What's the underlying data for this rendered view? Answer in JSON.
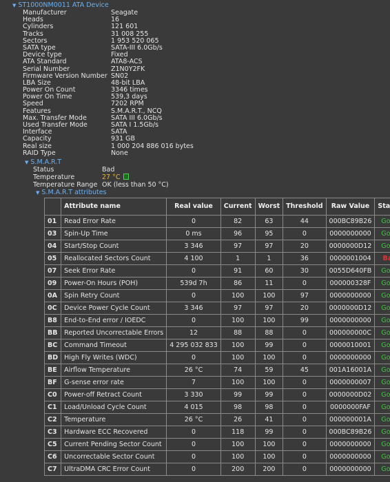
{
  "device": {
    "title": "ST1000NM0011 ATA Device"
  },
  "info": [
    {
      "key": "Manufacturer",
      "value": "Seagate"
    },
    {
      "key": "Heads",
      "value": "16"
    },
    {
      "key": "Cylinders",
      "value": "121 601"
    },
    {
      "key": "Tracks",
      "value": "31 008 255"
    },
    {
      "key": "Sectors",
      "value": "1 953 520 065"
    },
    {
      "key": "SATA type",
      "value": "SATA-III 6.0Gb/s"
    },
    {
      "key": "Device type",
      "value": "Fixed"
    },
    {
      "key": "ATA Standard",
      "value": "ATA8-ACS"
    },
    {
      "key": "Serial Number",
      "value": "Z1N0Y2FK"
    },
    {
      "key": "Firmware Version Number",
      "value": "SN02"
    },
    {
      "key": "LBA Size",
      "value": "48-bit LBA"
    },
    {
      "key": "Power On Count",
      "value": "3346 times"
    },
    {
      "key": "Power On Time",
      "value": "539,3 days"
    },
    {
      "key": "Speed",
      "value": "7202 RPM"
    },
    {
      "key": "Features",
      "value": "S.M.A.R.T., NCQ"
    },
    {
      "key": "Max. Transfer Mode",
      "value": "SATA III 6.0Gb/s"
    },
    {
      "key": "Used Transfer Mode",
      "value": "SATA I 1.5Gb/s"
    },
    {
      "key": "Interface",
      "value": "SATA"
    },
    {
      "key": "Capacity",
      "value": "931 GB"
    },
    {
      "key": "Real size",
      "value": "1 000 204 886 016 bytes"
    },
    {
      "key": "RAID Type",
      "value": "None"
    }
  ],
  "smart": {
    "title": "S.M.A.R.T",
    "status_label": "Status",
    "status_value": "Bad",
    "temp_label": "Temperature",
    "temp_value": "27 °C",
    "range_label": "Temperature Range",
    "range_value": "OK (less than 50 °C)",
    "attrs_title": "S.M.A.R.T attributes"
  },
  "table": {
    "headers": {
      "attribute": "Attribute name",
      "real": "Real value",
      "current": "Current",
      "worst": "Worst",
      "threshold": "Threshold",
      "raw": "Raw Value",
      "status": "Status"
    },
    "rows": [
      {
        "id": "01",
        "name": "Read Error Rate",
        "real": "0",
        "current": "82",
        "worst": "63",
        "threshold": "44",
        "raw": "000BC89B26",
        "status": "Good"
      },
      {
        "id": "03",
        "name": "Spin-Up Time",
        "real": "0 ms",
        "current": "96",
        "worst": "95",
        "threshold": "0",
        "raw": "0000000000",
        "status": "Good"
      },
      {
        "id": "04",
        "name": "Start/Stop Count",
        "real": "3 346",
        "current": "97",
        "worst": "97",
        "threshold": "20",
        "raw": "0000000D12",
        "status": "Good"
      },
      {
        "id": "05",
        "name": "Reallocated Sectors Count",
        "real": "4 100",
        "current": "1",
        "worst": "1",
        "threshold": "36",
        "raw": "0000001004",
        "status": "Bad"
      },
      {
        "id": "07",
        "name": "Seek Error Rate",
        "real": "0",
        "current": "91",
        "worst": "60",
        "threshold": "30",
        "raw": "0055D640FB",
        "status": "Good"
      },
      {
        "id": "09",
        "name": "Power-On Hours (POH)",
        "real": "539d 7h",
        "current": "86",
        "worst": "11",
        "threshold": "0",
        "raw": "000000328F",
        "status": "Good"
      },
      {
        "id": "0A",
        "name": "Spin Retry Count",
        "real": "0",
        "current": "100",
        "worst": "100",
        "threshold": "97",
        "raw": "0000000000",
        "status": "Good"
      },
      {
        "id": "0C",
        "name": "Device Power Cycle Count",
        "real": "3 346",
        "current": "97",
        "worst": "97",
        "threshold": "20",
        "raw": "0000000D12",
        "status": "Good"
      },
      {
        "id": "B8",
        "name": "End-to-End error / IOEDC",
        "real": "0",
        "current": "100",
        "worst": "100",
        "threshold": "99",
        "raw": "0000000000",
        "status": "Good"
      },
      {
        "id": "BB",
        "name": "Reported Uncorrectable Errors",
        "real": "12",
        "current": "88",
        "worst": "88",
        "threshold": "0",
        "raw": "000000000C",
        "status": "Good"
      },
      {
        "id": "BC",
        "name": "Command Timeout",
        "real": "4 295 032 833",
        "current": "100",
        "worst": "99",
        "threshold": "0",
        "raw": "0000010001",
        "status": "Good"
      },
      {
        "id": "BD",
        "name": "High Fly Writes (WDC)",
        "real": "0",
        "current": "100",
        "worst": "100",
        "threshold": "0",
        "raw": "0000000000",
        "status": "Good"
      },
      {
        "id": "BE",
        "name": "Airflow Temperature",
        "real": "26 °C",
        "current": "74",
        "worst": "59",
        "threshold": "45",
        "raw": "001A16001A",
        "status": "Good"
      },
      {
        "id": "BF",
        "name": "G-sense error rate",
        "real": "7",
        "current": "100",
        "worst": "100",
        "threshold": "0",
        "raw": "0000000007",
        "status": "Good"
      },
      {
        "id": "C0",
        "name": "Power-off Retract Count",
        "real": "3 330",
        "current": "99",
        "worst": "99",
        "threshold": "0",
        "raw": "0000000D02",
        "status": "Good"
      },
      {
        "id": "C1",
        "name": "Load/Unload Cycle Count",
        "real": "4 015",
        "current": "98",
        "worst": "98",
        "threshold": "0",
        "raw": "0000000FAF",
        "status": "Good"
      },
      {
        "id": "C2",
        "name": "Temperature",
        "real": "26 °C",
        "current": "26",
        "worst": "41",
        "threshold": "0",
        "raw": "000000001A",
        "status": "Good"
      },
      {
        "id": "C3",
        "name": "Hardware ECC Recovered",
        "real": "0",
        "current": "118",
        "worst": "99",
        "threshold": "0",
        "raw": "000BC89B26",
        "status": "Good"
      },
      {
        "id": "C5",
        "name": "Current Pending Sector Count",
        "real": "0",
        "current": "100",
        "worst": "100",
        "threshold": "0",
        "raw": "0000000000",
        "status": "Good"
      },
      {
        "id": "C6",
        "name": "Uncorrectable Sector Count",
        "real": "0",
        "current": "100",
        "worst": "100",
        "threshold": "0",
        "raw": "0000000000",
        "status": "Good"
      },
      {
        "id": "C7",
        "name": "UltraDMA CRC Error Count",
        "real": "0",
        "current": "200",
        "worst": "200",
        "threshold": "0",
        "raw": "0000000000",
        "status": "Good"
      }
    ]
  },
  "colors": {
    "good": "#3fc43f",
    "bad": "#e33333",
    "link": "#6ab0f3",
    "temp": "#e8b83a"
  },
  "icons": {
    "expand": "triangle-down-icon",
    "temp_indicator": "green-square-icon"
  }
}
